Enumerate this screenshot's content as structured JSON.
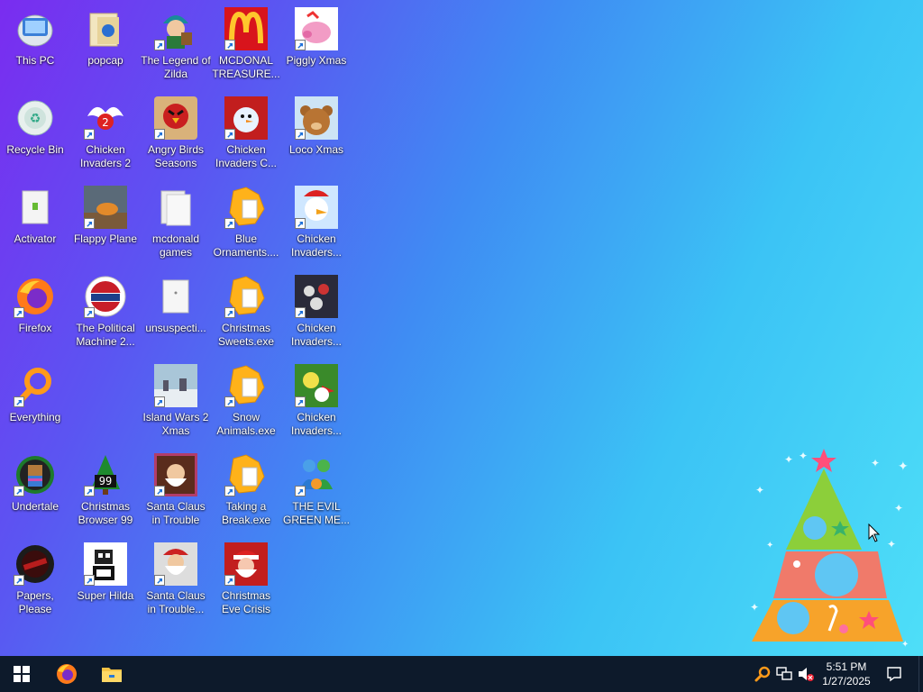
{
  "desktop": {
    "icons": [
      {
        "label": "This PC"
      },
      {
        "label": "popcap"
      },
      {
        "label": "The Legend of Zilda"
      },
      {
        "label": "MCDONAL TREASURE..."
      },
      {
        "label": "Piggly Xmas"
      },
      {
        "label": "Recycle Bin"
      },
      {
        "label": "Chicken Invaders 2"
      },
      {
        "label": "Angry Birds Seasons"
      },
      {
        "label": "Chicken Invaders C..."
      },
      {
        "label": "Loco Xmas"
      },
      {
        "label": "Activator"
      },
      {
        "label": "Flappy Plane"
      },
      {
        "label": "mcdonald games"
      },
      {
        "label": "Blue Ornaments...."
      },
      {
        "label": "Chicken Invaders..."
      },
      {
        "label": "Firefox"
      },
      {
        "label": "The Political Machine 2..."
      },
      {
        "label": "unsuspecti..."
      },
      {
        "label": "Christmas Sweets.exe"
      },
      {
        "label": "Chicken Invaders..."
      },
      {
        "label": "Everything"
      },
      {
        "label": "Island Wars 2 Xmas"
      },
      {
        "label": "Snow Animals.exe"
      },
      {
        "label": "Chicken Invaders..."
      },
      {
        "label": "Undertale"
      },
      {
        "label": "Christmas Browser 99"
      },
      {
        "label": "Santa Claus in Trouble"
      },
      {
        "label": "Taking a Break.exe"
      },
      {
        "label": "THE EVIL GREEN ME..."
      },
      {
        "label": "Papers, Please"
      },
      {
        "label": "Super Hilda"
      },
      {
        "label": "Santa Claus in Trouble... A..."
      },
      {
        "label": "Christmas Eve Crisis"
      }
    ]
  },
  "taskbar": {
    "pinned": [
      "windows-start",
      "firefox",
      "file-explorer"
    ],
    "clock": {
      "time": "5:51 PM",
      "date": "1/27/2025"
    }
  },
  "colors": {
    "taskbar": "#0d1a2b",
    "accent": "#ffb400"
  }
}
